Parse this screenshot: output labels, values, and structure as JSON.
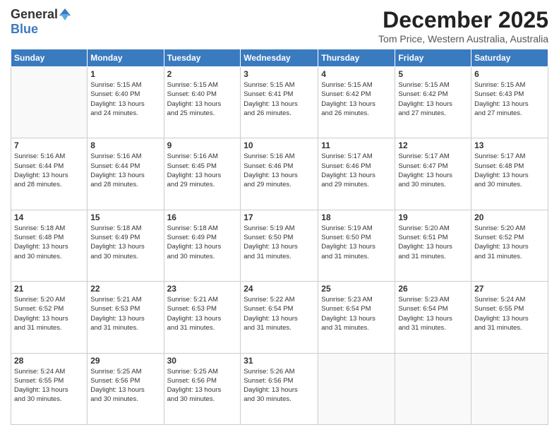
{
  "header": {
    "logo_general": "General",
    "logo_blue": "Blue",
    "month_title": "December 2025",
    "subtitle": "Tom Price, Western Australia, Australia"
  },
  "days_of_week": [
    "Sunday",
    "Monday",
    "Tuesday",
    "Wednesday",
    "Thursday",
    "Friday",
    "Saturday"
  ],
  "weeks": [
    [
      {
        "day": "",
        "info": ""
      },
      {
        "day": "1",
        "info": "Sunrise: 5:15 AM\nSunset: 6:40 PM\nDaylight: 13 hours\nand 24 minutes."
      },
      {
        "day": "2",
        "info": "Sunrise: 5:15 AM\nSunset: 6:40 PM\nDaylight: 13 hours\nand 25 minutes."
      },
      {
        "day": "3",
        "info": "Sunrise: 5:15 AM\nSunset: 6:41 PM\nDaylight: 13 hours\nand 26 minutes."
      },
      {
        "day": "4",
        "info": "Sunrise: 5:15 AM\nSunset: 6:42 PM\nDaylight: 13 hours\nand 26 minutes."
      },
      {
        "day": "5",
        "info": "Sunrise: 5:15 AM\nSunset: 6:42 PM\nDaylight: 13 hours\nand 27 minutes."
      },
      {
        "day": "6",
        "info": "Sunrise: 5:15 AM\nSunset: 6:43 PM\nDaylight: 13 hours\nand 27 minutes."
      }
    ],
    [
      {
        "day": "7",
        "info": "Sunrise: 5:16 AM\nSunset: 6:44 PM\nDaylight: 13 hours\nand 28 minutes."
      },
      {
        "day": "8",
        "info": "Sunrise: 5:16 AM\nSunset: 6:44 PM\nDaylight: 13 hours\nand 28 minutes."
      },
      {
        "day": "9",
        "info": "Sunrise: 5:16 AM\nSunset: 6:45 PM\nDaylight: 13 hours\nand 29 minutes."
      },
      {
        "day": "10",
        "info": "Sunrise: 5:16 AM\nSunset: 6:46 PM\nDaylight: 13 hours\nand 29 minutes."
      },
      {
        "day": "11",
        "info": "Sunrise: 5:17 AM\nSunset: 6:46 PM\nDaylight: 13 hours\nand 29 minutes."
      },
      {
        "day": "12",
        "info": "Sunrise: 5:17 AM\nSunset: 6:47 PM\nDaylight: 13 hours\nand 30 minutes."
      },
      {
        "day": "13",
        "info": "Sunrise: 5:17 AM\nSunset: 6:48 PM\nDaylight: 13 hours\nand 30 minutes."
      }
    ],
    [
      {
        "day": "14",
        "info": "Sunrise: 5:18 AM\nSunset: 6:48 PM\nDaylight: 13 hours\nand 30 minutes."
      },
      {
        "day": "15",
        "info": "Sunrise: 5:18 AM\nSunset: 6:49 PM\nDaylight: 13 hours\nand 30 minutes."
      },
      {
        "day": "16",
        "info": "Sunrise: 5:18 AM\nSunset: 6:49 PM\nDaylight: 13 hours\nand 30 minutes."
      },
      {
        "day": "17",
        "info": "Sunrise: 5:19 AM\nSunset: 6:50 PM\nDaylight: 13 hours\nand 31 minutes."
      },
      {
        "day": "18",
        "info": "Sunrise: 5:19 AM\nSunset: 6:50 PM\nDaylight: 13 hours\nand 31 minutes."
      },
      {
        "day": "19",
        "info": "Sunrise: 5:20 AM\nSunset: 6:51 PM\nDaylight: 13 hours\nand 31 minutes."
      },
      {
        "day": "20",
        "info": "Sunrise: 5:20 AM\nSunset: 6:52 PM\nDaylight: 13 hours\nand 31 minutes."
      }
    ],
    [
      {
        "day": "21",
        "info": "Sunrise: 5:20 AM\nSunset: 6:52 PM\nDaylight: 13 hours\nand 31 minutes."
      },
      {
        "day": "22",
        "info": "Sunrise: 5:21 AM\nSunset: 6:53 PM\nDaylight: 13 hours\nand 31 minutes."
      },
      {
        "day": "23",
        "info": "Sunrise: 5:21 AM\nSunset: 6:53 PM\nDaylight: 13 hours\nand 31 minutes."
      },
      {
        "day": "24",
        "info": "Sunrise: 5:22 AM\nSunset: 6:54 PM\nDaylight: 13 hours\nand 31 minutes."
      },
      {
        "day": "25",
        "info": "Sunrise: 5:23 AM\nSunset: 6:54 PM\nDaylight: 13 hours\nand 31 minutes."
      },
      {
        "day": "26",
        "info": "Sunrise: 5:23 AM\nSunset: 6:54 PM\nDaylight: 13 hours\nand 31 minutes."
      },
      {
        "day": "27",
        "info": "Sunrise: 5:24 AM\nSunset: 6:55 PM\nDaylight: 13 hours\nand 31 minutes."
      }
    ],
    [
      {
        "day": "28",
        "info": "Sunrise: 5:24 AM\nSunset: 6:55 PM\nDaylight: 13 hours\nand 30 minutes."
      },
      {
        "day": "29",
        "info": "Sunrise: 5:25 AM\nSunset: 6:56 PM\nDaylight: 13 hours\nand 30 minutes."
      },
      {
        "day": "30",
        "info": "Sunrise: 5:25 AM\nSunset: 6:56 PM\nDaylight: 13 hours\nand 30 minutes."
      },
      {
        "day": "31",
        "info": "Sunrise: 5:26 AM\nSunset: 6:56 PM\nDaylight: 13 hours\nand 30 minutes."
      },
      {
        "day": "",
        "info": ""
      },
      {
        "day": "",
        "info": ""
      },
      {
        "day": "",
        "info": ""
      }
    ]
  ]
}
